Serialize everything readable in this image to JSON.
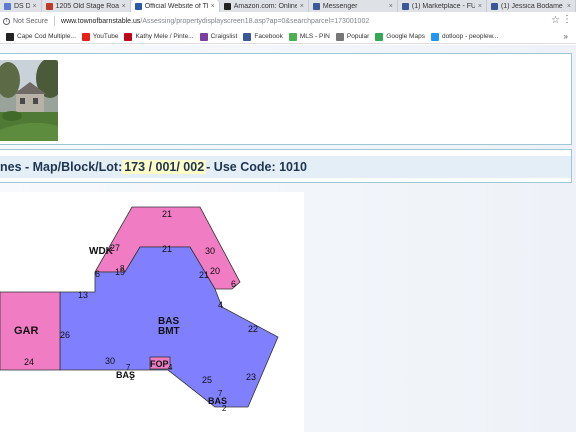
{
  "tabs": [
    {
      "label": "DS DIR",
      "color": "#5b7bd5",
      "active": false
    },
    {
      "label": "1205 Old Stage Road,",
      "color": "#c0392b",
      "active": false
    },
    {
      "label": "Official Website of Th",
      "color": "#2b5aa8",
      "active": true
    },
    {
      "label": "Amazon.com: Online S",
      "color": "#222222",
      "active": false
    },
    {
      "label": "Messenger",
      "color": "#3b5998",
      "active": false
    },
    {
      "label": "(1) Marketplace - FULL",
      "color": "#3b5998",
      "active": false
    },
    {
      "label": "(1) Jessica Bodame",
      "color": "#3b5998",
      "active": false
    }
  ],
  "addressbar": {
    "security_label": "Not Secure",
    "url_domain": "www.townofbarnstable.us",
    "url_path": "/Assessing/propertydisplayscreen18.asp?ap=0&searchparcel=173001002"
  },
  "bookmarks": [
    {
      "label": "Cape Cod Multiple...",
      "color": "#222222"
    },
    {
      "label": "YouTube",
      "color": "#e62117"
    },
    {
      "label": "Kathy Mele / Pinte...",
      "color": "#bd081c"
    },
    {
      "label": "Craigslist",
      "color": "#7b3fa0"
    },
    {
      "label": "Facebook",
      "color": "#3b5998"
    },
    {
      "label": "MLS - PIN",
      "color": "#4caf50"
    },
    {
      "label": "Popular",
      "color": "#777777"
    },
    {
      "label": "Google Maps",
      "color": "#34a853"
    },
    {
      "label": "dotloop - peoplew...",
      "color": "#2196f3"
    }
  ],
  "bookmarks_more": "»",
  "header": {
    "prefix": "nes - Map/Block/Lot: ",
    "lot": "173 / 001/ 002",
    "suffix": " - Use Code: 1010"
  },
  "sketch": {
    "colors": {
      "pink": "#f07cc4",
      "blue": "#8080ff"
    },
    "areas": {
      "gar": "GAR",
      "bas": "BAS",
      "bmt": "BMT",
      "wdk": "WDK",
      "fop": "FOP",
      "bas_small1": "BAS",
      "bas_small2": "BAS"
    },
    "dims": [
      "21",
      "21",
      "27",
      "30",
      "6",
      "19",
      "8",
      "21",
      "20",
      "6",
      "13",
      "4",
      "22",
      "26",
      "24",
      "30",
      "7",
      "2",
      "4",
      "25",
      "23",
      "7",
      "2"
    ]
  }
}
